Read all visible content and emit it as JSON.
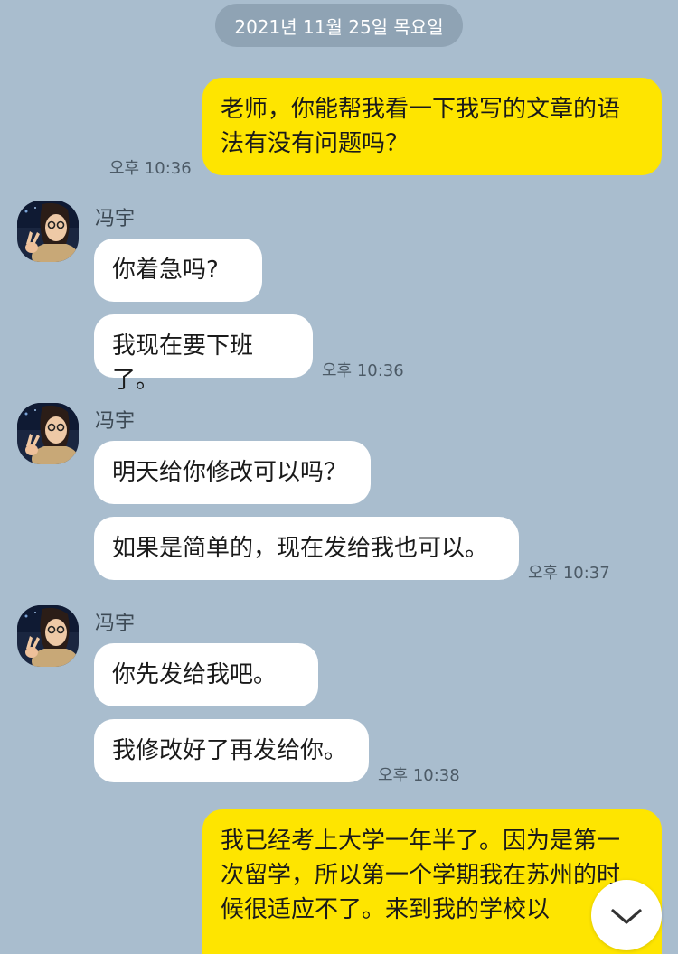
{
  "chat": {
    "date_divider": "2021년 11월 25일 목요일",
    "messages": [
      {
        "text": "老师，你能帮我看一下我写的文章的语\n法有没有问题吗？",
        "time": "오후 10:36"
      },
      {
        "sender": "冯宇",
        "text": "你着急吗?"
      },
      {
        "text": "我现在要下班了。",
        "time": "오후 10:36"
      },
      {
        "sender": "冯宇",
        "text": "明天给你修改可以吗？"
      },
      {
        "text": "如果是简单的，现在发给我也可以。",
        "time": "오후 10:37"
      },
      {
        "sender": "冯宇",
        "text": "你先发给我吧。"
      },
      {
        "text": "我修改好了再发给你。",
        "time": "오후 10:38"
      },
      {
        "text": "我已经考上大学一年半了。因为是第一\n次留学，所以第一个学期我在苏州的时\n候很适应不了。来到我的学校以"
      }
    ]
  },
  "icons": {
    "avatar": "profile-photo",
    "scroll_down": "chevron-down-icon"
  },
  "colors": {
    "background": "#a9bdce",
    "my_bubble": "#fee500",
    "their_bubble": "#ffffff"
  }
}
